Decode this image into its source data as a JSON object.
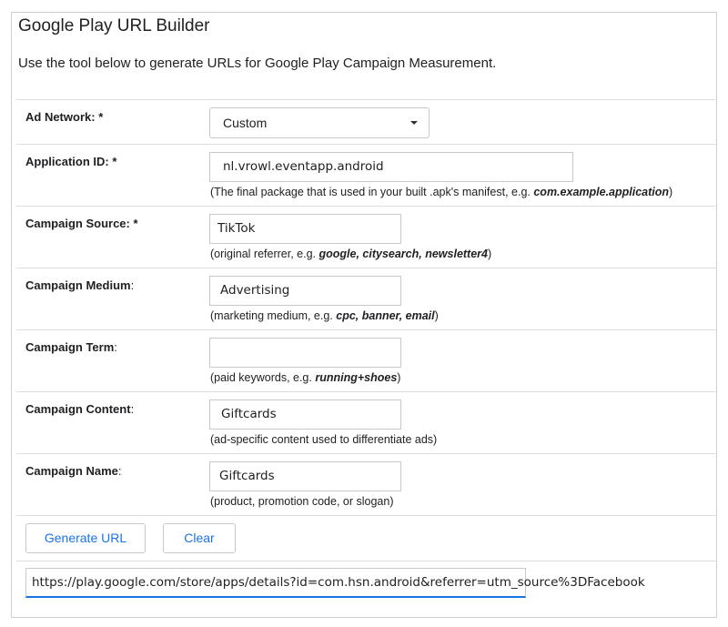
{
  "header": {
    "title": "Google Play URL Builder",
    "description": "Use the tool below to generate URLs for Google Play Campaign Measurement."
  },
  "fields": {
    "ad_network": {
      "label": "Ad Network:",
      "required": "*",
      "value": "Custom"
    },
    "application_id": {
      "label": "Application ID:",
      "required": "*",
      "value": "nl.vrowl.eventapp.android",
      "hint_prefix": "(The final package that is used in your built .apk's manifest, e.g. ",
      "hint_example": "com.example.application",
      "hint_suffix": ")"
    },
    "campaign_source": {
      "label": "Campaign Source:",
      "required": "*",
      "value": "TikTok",
      "hint_prefix": "(original referrer, e.g. ",
      "hint_example": "google, citysearch, newsletter4",
      "hint_suffix": ")"
    },
    "campaign_medium": {
      "label": "Campaign Medium",
      "colon": ":",
      "value": "Advertising",
      "hint_prefix": "(marketing medium, e.g. ",
      "hint_example": "cpc, banner, email",
      "hint_suffix": ")"
    },
    "campaign_term": {
      "label": "Campaign Term",
      "colon": ":",
      "value": "",
      "hint_prefix": "(paid keywords, e.g. ",
      "hint_example": "running+shoes",
      "hint_suffix": ")"
    },
    "campaign_content": {
      "label": "Campaign Content",
      "colon": ":",
      "value": "Giftcards",
      "hint": "(ad-specific content used to differentiate ads)"
    },
    "campaign_name": {
      "label": "Campaign Name",
      "colon": ":",
      "value": "Giftcards",
      "hint": "(product, promotion code, or slogan)"
    }
  },
  "buttons": {
    "generate": "Generate URL",
    "clear": "Clear"
  },
  "result_url": "https://play.google.com/store/apps/details?id=com.hsn.android&referrer=utm_source%3DFacebook",
  "colors": {
    "accent": "#1a73e8",
    "border": "#c8c8c8",
    "divider": "#dadce0"
  }
}
